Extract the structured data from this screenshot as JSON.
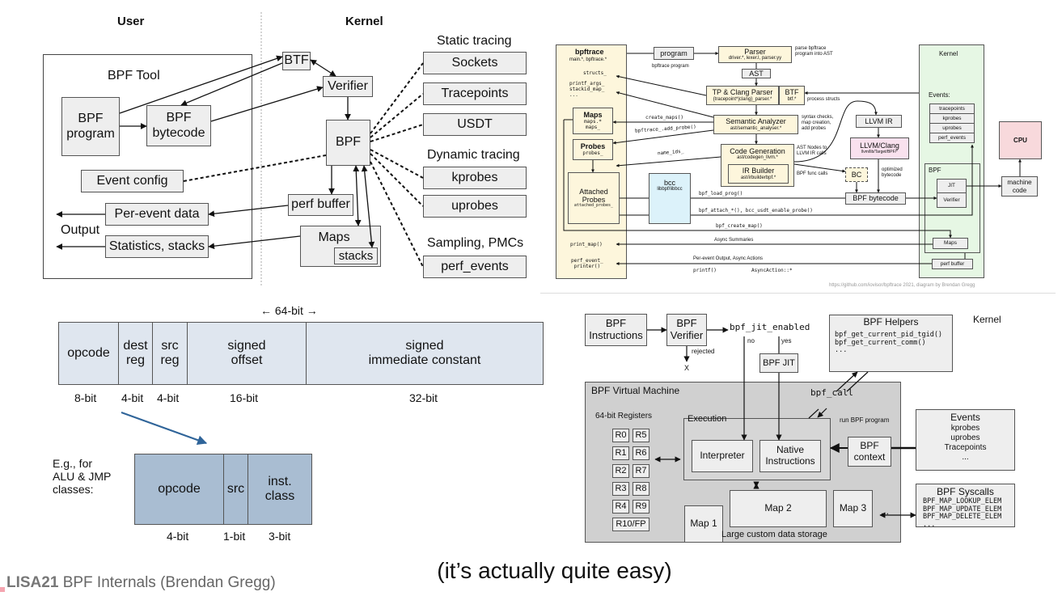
{
  "overview": {
    "user_heading": "User",
    "kernel_heading": "Kernel",
    "bpf_tool": "BPF Tool",
    "bpf_program": "BPF\nprogram",
    "bpf_bytecode": "BPF\nbytecode",
    "event_config": "Event config",
    "per_event_data": "Per-event data",
    "statistics": "Statistics, stacks",
    "output": "Output",
    "btf": "BTF",
    "verifier": "Verifier",
    "bpf": "BPF",
    "perf_buffer": "perf buffer",
    "maps": "Maps",
    "stacks": "stacks",
    "static_tracing": "Static tracing",
    "sockets": "Sockets",
    "tracepoints": "Tracepoints",
    "usdt": "USDT",
    "dynamic_tracing": "Dynamic tracing",
    "kprobes": "kprobes",
    "uprobes": "uprobes",
    "sampling": "Sampling, PMCs",
    "perf_events": "perf_events"
  },
  "bpftrace": {
    "panel_title": "bpftrace",
    "panel_sub": "main.*, bpftrace.*",
    "structs": "structs_",
    "printf_args": "printf_args_\nstackid_map_\n...",
    "maps": "Maps",
    "maps_sub": "maps.*\nmaps_",
    "probes": "Probes",
    "probes_sub": "probes_",
    "attached": "Attached\nProbes",
    "attached_sub": "attached_probes_",
    "print_map": "print_map()",
    "perf_printer": "perf_event_\nprinter()",
    "program": "program",
    "program_note": "bpftrace program",
    "parser": "Parser",
    "parser_sub": "driver.*, lexer.l, parser.yy",
    "parser_note": "parse bpftrace\nprogram into AST",
    "ast": "AST",
    "tp_parser": "TP & Clang Parser",
    "tp_parser_sub": "{tracepoint*|clang}_parser.*",
    "btf": "BTF",
    "btf_sub": "btf.*",
    "process_structs": "process structs",
    "sema": "Semantic Analyzer",
    "sema_sub": "ast/semantic_analyser.*",
    "sema_note": "syntax checks,\nmap creation,\nadd probes",
    "codegen": "Code Generation",
    "codegen_sub": "ast/codegen_llvm.*",
    "codegen_note": "AST Nodes to\nLLVM IR calls",
    "irbuilder": "IR Builder",
    "irbuilder_sub": "ast/irbuilderbpf.*",
    "func_calls": "BPF func calls",
    "create_maps": "create_maps()",
    "add_probe": "bpftrace_.add_probe()",
    "name_ids": "name_ids_",
    "bcc": "bcc",
    "bcc_sub": "libbpf/libbcc",
    "load_prog": "bpf_load_prog()",
    "attach": "bpf_attach_*(), bcc_usdt_enable_probe()",
    "create_map": "bpf_create_map()",
    "async_summaries": "Async Summaries",
    "per_event_output": "Per-event Output, Async Actions",
    "printf": "printf()",
    "async_action": "AsyncAction::*",
    "llvm_ir": "LLVM IR",
    "llvm_clang": "LLVM/Clang",
    "llvm_clang_sub": "llvm/lib/Target/BPF/*",
    "bc": "BC",
    "optimized": "optimized\nbytecode",
    "bpf_bytecode": "BPF bytecode",
    "kernel": "Kernel",
    "events_label": "Events:",
    "events": [
      "tracepoints",
      "kprobes",
      "uprobes",
      "perf_events"
    ],
    "bpf": "BPF",
    "jit": "JIT",
    "verifier": "Verifier",
    "kmaps": "Maps",
    "perf_buffer": "perf buffer",
    "cpu": "CPU",
    "machine_code": "machine\ncode",
    "credit": "https://github.com/iovisor/bpftrace 2021, diagram by Brendan Gregg"
  },
  "encoding": {
    "width_label": "← 64-bit →",
    "fields": [
      "opcode",
      "dest\nreg",
      "src\nreg",
      "signed\noffset",
      "signed\nimmediate constant"
    ],
    "bits": [
      "8-bit",
      "4-bit",
      "4-bit",
      "16-bit",
      "32-bit"
    ],
    "example_label": "E.g., for\nALU & JMP\nclasses:",
    "sub_fields": [
      "opcode",
      "src",
      "inst.\nclass"
    ],
    "sub_bits": [
      "4-bit",
      "1-bit",
      "3-bit"
    ],
    "colors": {
      "main": "#dfe6ef",
      "sub": "#a9bdd2",
      "arrow": "#2f6499"
    }
  },
  "vm": {
    "instructions": "BPF\nInstructions",
    "verifier": "BPF\nVerifier",
    "jit_enabled": "bpf_jit_enabled",
    "rejected": "rejected",
    "x": "X",
    "no": "no",
    "yes": "yes",
    "jit": "BPF JIT",
    "helpers_title": "BPF Helpers",
    "helpers": "bpf_get_current_pid_tgid()\nbpf_get_current_comm()\n...",
    "kernel": "Kernel",
    "vm_title": "BPF Virtual Machine",
    "registers_title": "64-bit Registers",
    "registers": [
      "R0",
      "R5",
      "R1",
      "R6",
      "R2",
      "R7",
      "R3",
      "R8",
      "R4",
      "R9"
    ],
    "r10": "R10/FP",
    "execution": "Execution",
    "interpreter": "Interpreter",
    "native": "Native\nInstructions",
    "bpf_call": "bpf_call",
    "run_program": "run BPF program",
    "context": "BPF\ncontext",
    "events_title": "Events",
    "events": "kprobes\nuprobes\nTracepoints\n...",
    "maps": [
      "Map 1",
      "Map 2",
      "Map 3"
    ],
    "maps_more": "...",
    "storage": "Large custom data storage",
    "syscalls_title": "BPF Syscalls",
    "syscalls": "BPF_MAP_LOOKUP_ELEM\nBPF_MAP_UPDATE_ELEM\nBPF_MAP_DELETE_ELEM\n..."
  },
  "slide": {
    "subtitle": "(it’s actually quite easy)",
    "footer_logo": "LISA21",
    "footer_title": "BPF Internals (Brendan Gregg)"
  }
}
